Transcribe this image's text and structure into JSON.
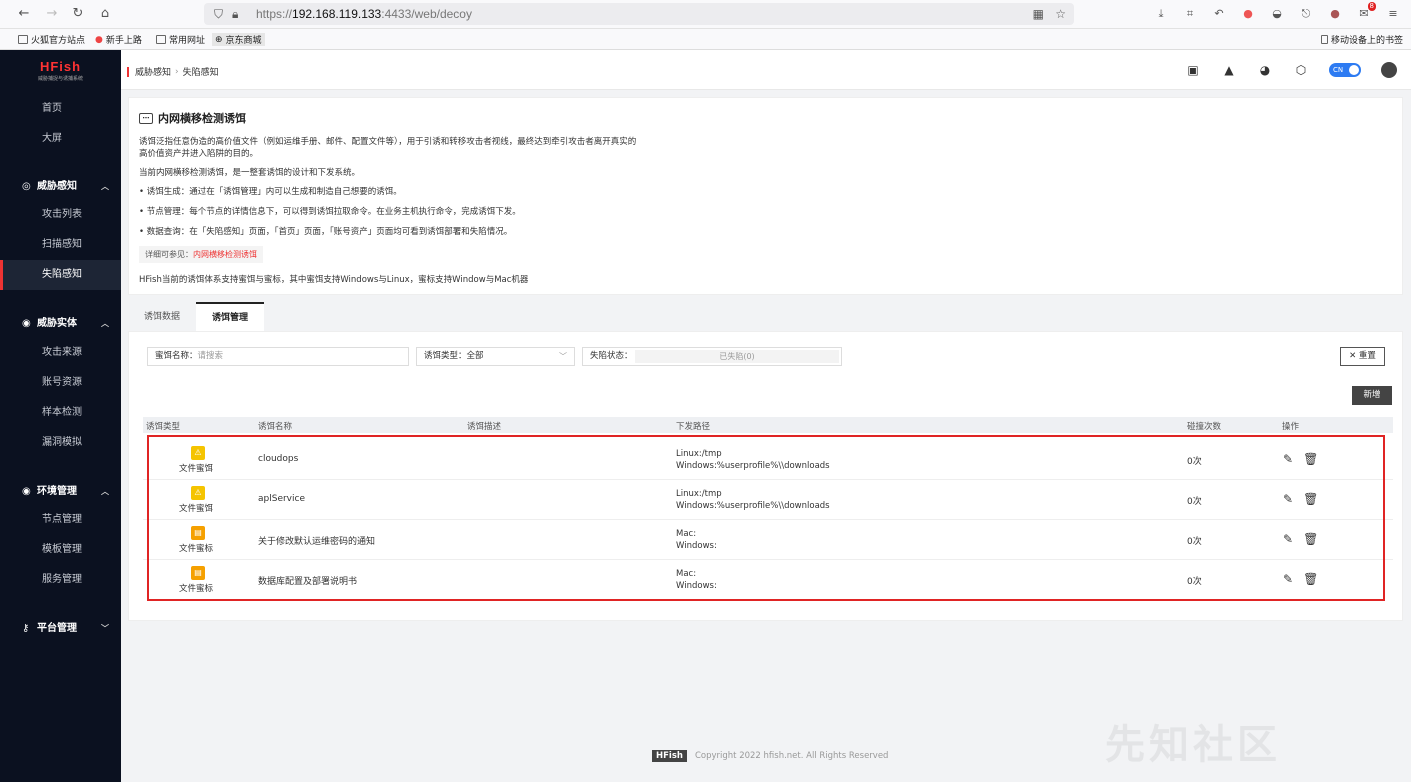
{
  "browser": {
    "url_scheme": "https://",
    "url_host": "192.168.119.133",
    "url_rest": ":4433/web/decoy",
    "bookmarks": [
      "火狐官方站点",
      "新手上路",
      "常用网址",
      "京东商城"
    ],
    "mobile_bookmarks": "移动设备上的书签",
    "badge_count": "8"
  },
  "sidebar": {
    "logo": "HFish",
    "logo_sub": "威胁捕捉与诱捕系统",
    "home": "首页",
    "screen": "大屏",
    "groups": [
      {
        "label": "威胁感知",
        "items": [
          "攻击列表",
          "扫描感知",
          "失陷感知"
        ]
      },
      {
        "label": "威胁实体",
        "items": [
          "攻击来源",
          "账号资源",
          "样本检测",
          "漏洞模拟"
        ]
      },
      {
        "label": "环境管理",
        "items": [
          "节点管理",
          "模板管理",
          "服务管理"
        ]
      },
      {
        "label": "平台管理",
        "items": []
      }
    ]
  },
  "header": {
    "crumb1": "威胁感知",
    "crumb2": "失陷感知",
    "lang": "CN"
  },
  "intro": {
    "title": "内网横移检测诱饵",
    "p1": "诱饵泛指任意伪造的高价值文件（例如运维手册、邮件、配置文件等），用于引诱和转移攻击者视线，最终达到牵引攻击者离开真实的",
    "p1b": "高价值资产并进入陷阱的目的。",
    "p2": "当前内网横移检测诱饵，是一整套诱饵的设计和下发系统。",
    "b1": "• 诱饵生成：通过在「诱饵管理」内可以生成和制造自己想要的诱饵。",
    "b2": "• 节点管理：每个节点的详情信息下，可以得到诱饵拉取命令。在业务主机执行命令，完成诱饵下发。",
    "b3": "• 数据查询：在「失陷感知」页面，「首页」页面，「账号资产」页面均可看到诱饵部署和失陷情况。",
    "note_prefix": "详细可参见：",
    "note_link": "内网横移检测诱饵",
    "p3": "HFish当前的诱饵体系支持蜜饵与蜜标，其中蜜饵支持Windows与Linux，蜜标支持Window与Mac机器"
  },
  "tabs": [
    "诱饵数据",
    "诱饵管理"
  ],
  "filters": {
    "name_label": "蜜饵名称：",
    "name_placeholder": "请搜索",
    "type_label": "诱饵类型：",
    "type_value": "全部",
    "status_label": "失陷状态：",
    "status_value": "已失陷(0)",
    "reset": "重置",
    "new": "新增"
  },
  "table": {
    "columns": [
      "诱饵类型",
      "诱饵名称",
      "诱饵描述",
      "下发路径",
      "碰撞次数",
      "操作"
    ],
    "rows": [
      {
        "type": "文件蜜饵",
        "name": "cloudops",
        "desc": "",
        "path1": "Linux:/tmp",
        "path2": "Windows:%userprofile%\\\\downloads",
        "hits": "0次"
      },
      {
        "type": "文件蜜饵",
        "name": "aplService",
        "desc": "",
        "path1": "Linux:/tmp",
        "path2": "Windows:%userprofile%\\\\downloads",
        "hits": "0次"
      },
      {
        "type": "文件蜜标",
        "name": "关于修改默认运维密码的通知",
        "desc": "",
        "path1": "Mac:",
        "path2": "Windows:",
        "hits": "0次"
      },
      {
        "type": "文件蜜标",
        "name": "数据库配置及部署说明书",
        "desc": "",
        "path1": "Mac:",
        "path2": "Windows:",
        "hits": "0次"
      }
    ]
  },
  "footer": {
    "logo": "HFish",
    "copyright": "Copyright 2022 hfish.net. All Rights Reserved"
  },
  "watermark": "先知社区"
}
